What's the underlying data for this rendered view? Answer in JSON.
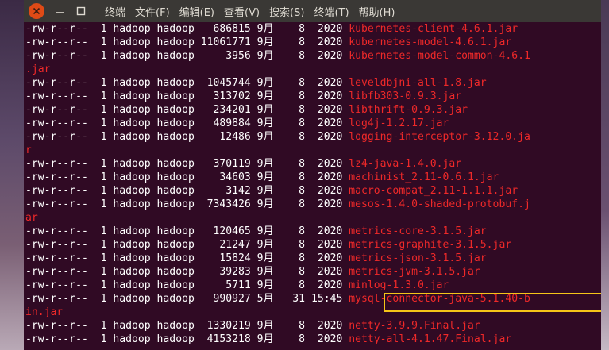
{
  "window": {
    "controls": {
      "close_glyph": "✕",
      "minimize_glyph": "—",
      "maximize_glyph": "☐"
    },
    "menu": [
      {
        "label": "终端"
      },
      {
        "label": "文件(F)"
      },
      {
        "label": "编辑(E)"
      },
      {
        "label": "查看(V)"
      },
      {
        "label": "搜索(S)"
      },
      {
        "label": "终端(T)"
      },
      {
        "label": "帮助(H)"
      }
    ]
  },
  "terminal": {
    "highlight_color": "#f5c518",
    "lines": [
      {
        "meta": "-rw-r--r--  1 hadoop hadoop   686815 9月    8  2020 ",
        "file": "kubernetes-client-4.6.1.jar"
      },
      {
        "meta": "-rw-r--r--  1 hadoop hadoop 11061771 9月    8  2020 ",
        "file": "kubernetes-model-4.6.1.jar"
      },
      {
        "meta": "-rw-r--r--  1 hadoop hadoop     3956 9月    8  2020 ",
        "file": "kubernetes-model-common-4.6.1"
      },
      {
        "meta": "",
        "file": ".jar"
      },
      {
        "meta": "-rw-r--r--  1 hadoop hadoop  1045744 9月    8  2020 ",
        "file": "leveldbjni-all-1.8.jar"
      },
      {
        "meta": "-rw-r--r--  1 hadoop hadoop   313702 9月    8  2020 ",
        "file": "libfb303-0.9.3.jar"
      },
      {
        "meta": "-rw-r--r--  1 hadoop hadoop   234201 9月    8  2020 ",
        "file": "libthrift-0.9.3.jar"
      },
      {
        "meta": "-rw-r--r--  1 hadoop hadoop   489884 9月    8  2020 ",
        "file": "log4j-1.2.17.jar"
      },
      {
        "meta": "-rw-r--r--  1 hadoop hadoop    12486 9月    8  2020 ",
        "file": "logging-interceptor-3.12.0.ja"
      },
      {
        "meta": "",
        "file": "r"
      },
      {
        "meta": "-rw-r--r--  1 hadoop hadoop   370119 9月    8  2020 ",
        "file": "lz4-java-1.4.0.jar"
      },
      {
        "meta": "-rw-r--r--  1 hadoop hadoop    34603 9月    8  2020 ",
        "file": "machinist_2.11-0.6.1.jar"
      },
      {
        "meta": "-rw-r--r--  1 hadoop hadoop     3142 9月    8  2020 ",
        "file": "macro-compat_2.11-1.1.1.jar"
      },
      {
        "meta": "-rw-r--r--  1 hadoop hadoop  7343426 9月    8  2020 ",
        "file": "mesos-1.4.0-shaded-protobuf.j"
      },
      {
        "meta": "",
        "file": "ar"
      },
      {
        "meta": "-rw-r--r--  1 hadoop hadoop   120465 9月    8  2020 ",
        "file": "metrics-core-3.1.5.jar"
      },
      {
        "meta": "-rw-r--r--  1 hadoop hadoop    21247 9月    8  2020 ",
        "file": "metrics-graphite-3.1.5.jar"
      },
      {
        "meta": "-rw-r--r--  1 hadoop hadoop    15824 9月    8  2020 ",
        "file": "metrics-json-3.1.5.jar"
      },
      {
        "meta": "-rw-r--r--  1 hadoop hadoop    39283 9月    8  2020 ",
        "file": "metrics-jvm-3.1.5.jar"
      },
      {
        "meta": "-rw-r--r--  1 hadoop hadoop     5711 9月    8  2020 ",
        "file": "minlog-1.3.0.jar"
      },
      {
        "meta": "-rw-r--r--  1 hadoop hadoop   990927 5月   31 15:45 ",
        "file": "mysql-connector-java-5.1.40-b"
      },
      {
        "meta": "",
        "file": "in.jar"
      },
      {
        "meta": "-rw-r--r--  1 hadoop hadoop  1330219 9月    8  2020 ",
        "file": "netty-3.9.9.Final.jar"
      },
      {
        "meta": "-rw-r--r--  1 hadoop hadoop  4153218 9月    8  2020 ",
        "file": "netty-all-4.1.47.Final.jar"
      }
    ]
  }
}
